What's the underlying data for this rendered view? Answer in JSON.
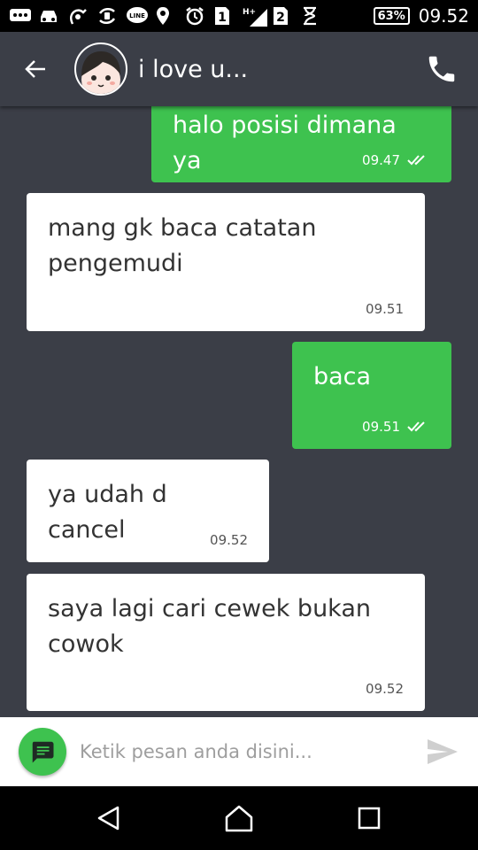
{
  "status_bar": {
    "icons": [
      "messages-icon",
      "car-icon",
      "hand-icon",
      "phone-sync-icon",
      "line-icon",
      "location-icon",
      "alarm-icon",
      "sim1-icon",
      "h-plus-signal-icon",
      "sim2-icon",
      "hourglass-icon"
    ],
    "sim1": "1",
    "network_type": "H+",
    "sim2": "2",
    "battery": "63%",
    "time": "09.52"
  },
  "header": {
    "contact_name": "i love u..."
  },
  "messages": [
    {
      "direction": "out",
      "text": "halo posisi dimana ya",
      "time": "09.47",
      "read": true
    },
    {
      "direction": "in",
      "text": "mang gk baca catatan pengemudi",
      "time": "09.51"
    },
    {
      "direction": "out",
      "text": "baca",
      "time": "09.51",
      "read": true
    },
    {
      "direction": "in",
      "text": "ya udah d cancel",
      "time": "09.52"
    },
    {
      "direction": "in",
      "text": "saya lagi cari cewek bukan cowok",
      "time": "09.52"
    }
  ],
  "composer": {
    "placeholder": "Ketik pesan anda disini...",
    "value": ""
  },
  "colors": {
    "background": "#3b3e47",
    "outgoing_bubble": "#3ec24f",
    "incoming_bubble": "#ffffff"
  }
}
